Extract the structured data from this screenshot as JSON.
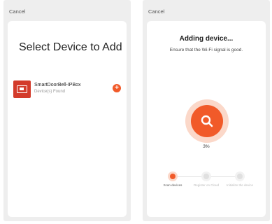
{
  "left_screen": {
    "cancel_label": "Cancel",
    "title": "Select Device to Add",
    "device": {
      "name": "SmartDoorBell-IPBox",
      "status": "Device(s) Found",
      "icon": "doorbell-device-icon"
    },
    "add_icon": "plus-icon"
  },
  "right_screen": {
    "cancel_label": "Cancel",
    "title": "Adding device...",
    "subtitle": "Ensure that the Wi-Fi signal is good.",
    "progress_percent": "3%",
    "progress_value": 0.03,
    "center_icon": "search-icon",
    "steps": [
      {
        "label": "Scan devices",
        "state": "active"
      },
      {
        "label": "Register on Cloud",
        "state": "pending"
      },
      {
        "label": "Initialize the device",
        "state": "pending"
      }
    ]
  },
  "colors": {
    "accent": "#f15a29",
    "accent_light": "#fbd8c9",
    "device_red": "#d33b2b",
    "panel_bg": "#eeeeee"
  }
}
